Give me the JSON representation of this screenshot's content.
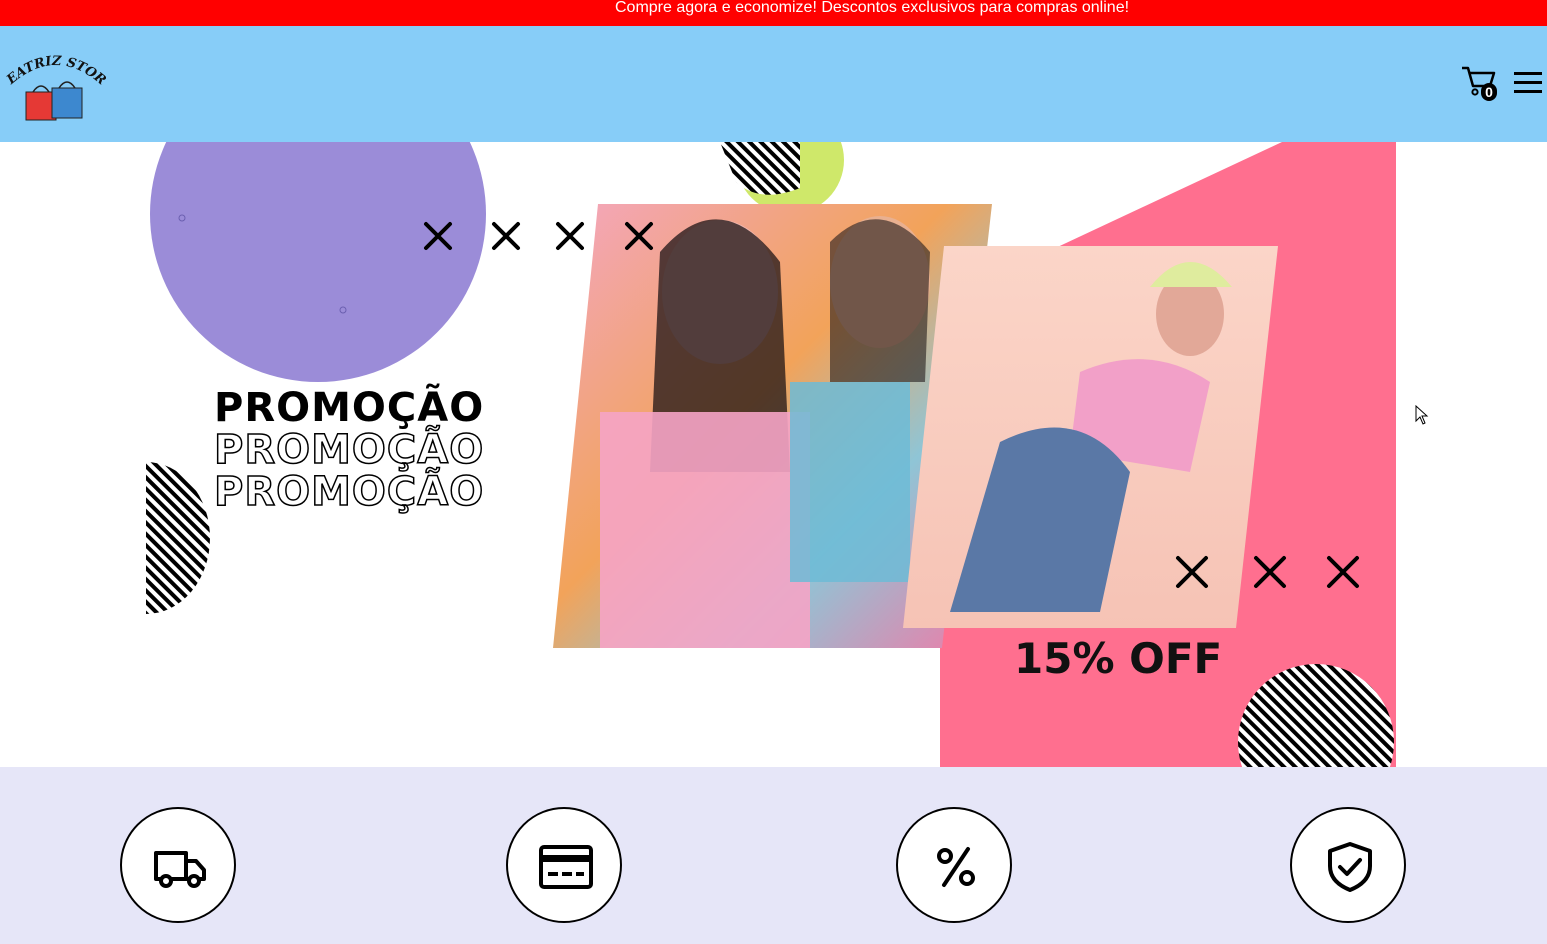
{
  "announcement": "Compre agora e economize! Descontos exclusivos para compras online!",
  "header": {
    "logo_text": "BEATRIZ STORE",
    "cart_count": "0"
  },
  "banner": {
    "headline": "PROMOÇÃO",
    "headline_repeat_1": "PROMOÇÃO",
    "headline_repeat_2": "PROMOÇÃO",
    "discount": "15% OFF"
  },
  "features": [
    {
      "icon": "truck-icon"
    },
    {
      "icon": "credit-card-icon"
    },
    {
      "icon": "percent-icon"
    },
    {
      "icon": "shield-check-icon"
    }
  ],
  "colors": {
    "announcement_bg": "#ff0000",
    "header_bg": "#87cdf8",
    "features_bg": "#e6e6f8",
    "purple_circle": "#9b8cd8",
    "pink_triangle": "#ff6f8f",
    "lime_circle": "#cfe86a"
  }
}
